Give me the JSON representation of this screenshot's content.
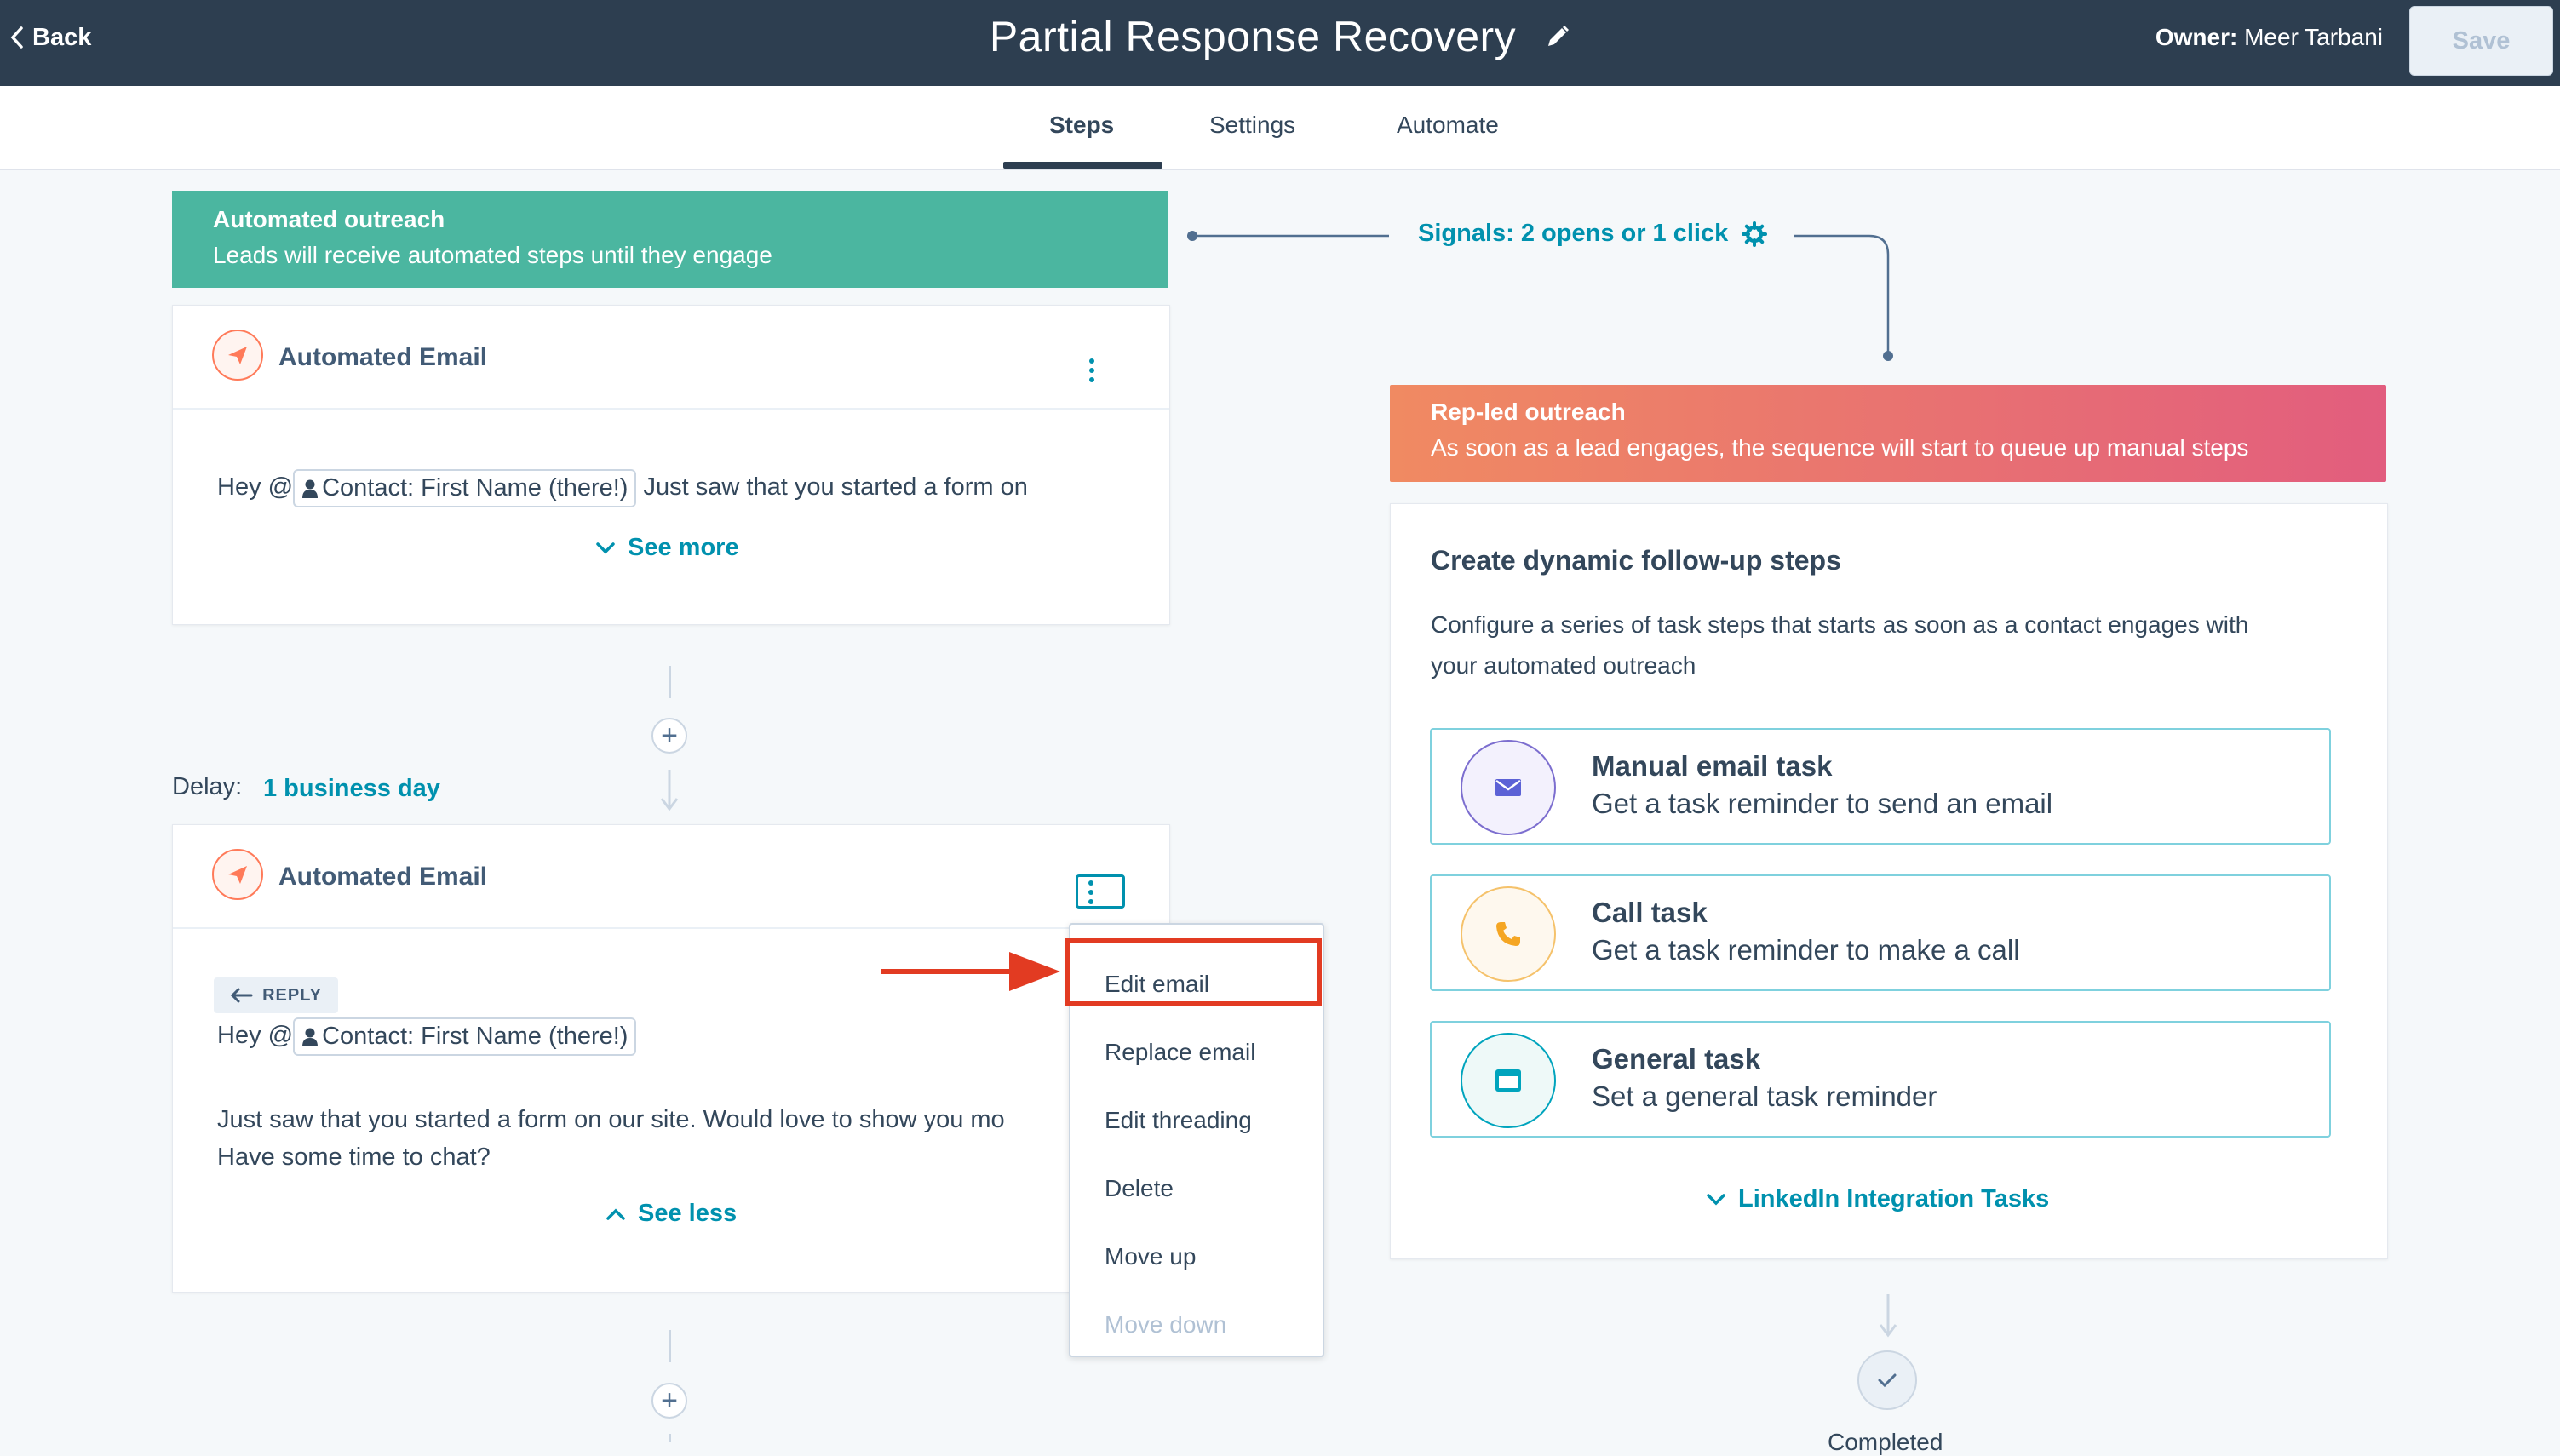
{
  "header": {
    "back_label": "Back",
    "title": "Partial Response Recovery",
    "owner_label": "Owner:",
    "owner_name": "Meer Tarbani",
    "save_label": "Save"
  },
  "tabs": [
    {
      "label": "Steps",
      "active": true
    },
    {
      "label": "Settings",
      "active": false
    },
    {
      "label": "Automate",
      "active": false
    }
  ],
  "automated_banner": {
    "title": "Automated outreach",
    "subtitle": "Leads will receive automated steps until they engage",
    "color": "#4bb6a0"
  },
  "signals_label": "Signals: 2 opens or 1 click",
  "steps": [
    {
      "title": "Automated Email",
      "greeting": "Hey @",
      "token": "Contact: First Name (there!)",
      "preview_rest": "Just saw that you started a form on",
      "toggle_label": "See more"
    },
    {
      "title": "Automated Email",
      "reply_badge": "REPLY",
      "greeting": "Hey @",
      "token": "Contact: First Name (there!)",
      "body_line1": "Just saw that you started a form on our site. Would love to show you mo",
      "body_line2": "Have some time to chat?",
      "toggle_label": "See less"
    }
  ],
  "delay": {
    "label": "Delay:",
    "value": "1 business day"
  },
  "step_menu": {
    "items": [
      {
        "label": "Edit email",
        "disabled": false,
        "highlighted": true
      },
      {
        "label": "Replace email",
        "disabled": false
      },
      {
        "label": "Edit threading",
        "disabled": false
      },
      {
        "label": "Delete",
        "disabled": false
      },
      {
        "label": "Move up",
        "disabled": false
      },
      {
        "label": "Move down",
        "disabled": true
      }
    ]
  },
  "rep_banner": {
    "title": "Rep-led outreach",
    "subtitle": "As soon as a lead engages, the sequence will start to queue up manual steps",
    "color_start": "#f08a62",
    "color_end": "#e25d7e"
  },
  "dynamic_panel": {
    "title": "Create dynamic follow-up steps",
    "desc_line1": "Configure a series of task steps that starts as soon as a contact engages with",
    "desc_line2": "your automated outreach",
    "options": [
      {
        "title": "Manual email task",
        "desc": "Get a task reminder to send an email",
        "icon": "envelope-icon"
      },
      {
        "title": "Call task",
        "desc": "Get a task reminder to make a call",
        "icon": "phone-icon"
      },
      {
        "title": "General task",
        "desc": "Set a general task reminder",
        "icon": "task-icon"
      }
    ],
    "linkedin_label": "LinkedIn Integration Tasks"
  },
  "completed_label": "Completed"
}
